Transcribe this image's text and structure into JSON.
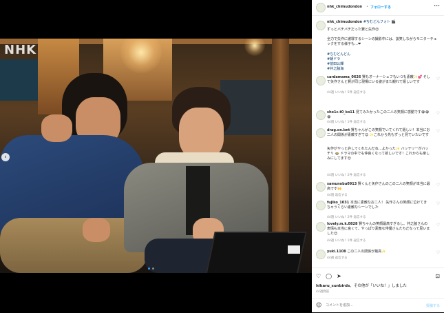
{
  "photo": {
    "watermark": "NHK"
  },
  "header": {
    "username": "nhk_chimudondon",
    "separator": "•",
    "follow": "フォローする",
    "more": "•••"
  },
  "caption": {
    "username": "nhk_chimudondon",
    "line1": "#ちむどんフォト 🎬",
    "line2": "ずっとバチバチだった賢と矢作😊",
    "line3": "全力で矢作に謝罪するシーンの撮影中には、談笑しながらモニターチェックをする様子も…❤",
    "tags": [
      "#ちむどんどん",
      "#朝ドラ",
      "#前田公輝",
      "#井之脇海"
    ]
  },
  "comments": [
    {
      "user": "cardamama_0626",
      "text": "賢もオーナーシェフもいつも素敵✨💕 そして矢作さんと賢が同じ現場にいる姿がまた観れて嬉しいです",
      "meta": [
        "44週",
        "いいね！5件",
        "返信する"
      ]
    },
    {
      "user": "sho1c.t0_ko11",
      "text": "見てみたかったこの二人の笑顔に感動です😭😭😭",
      "meta": [
        "44週",
        "いいね！1件",
        "返信する"
      ]
    },
    {
      "user": "drag.on.bnt",
      "text": "賢ちゃんがこの笑顔でいてくれて嬉しい！本当にお二人の関係が素敵すぎて😊 ✨これから先もずっと見ていたいです",
      "meta": [
        "44週",
        "いいね！4件",
        "返信する"
      ]
    },
    {
      "user": "",
      "text": "矢作がやっと許してくれたんだね…よかった✨ バッテリーがバッチリ 🍲 ドラマの中でも仲良くなって欲しいです！これからも楽しみにしてます😊",
      "meta": [
        "44週",
        "いいね！2件",
        "返信する"
      ]
    },
    {
      "user": "samunobu0913",
      "text": "賢くんと矢作さんのこの二人の笑顔が本当に最高です🙌",
      "meta": [
        "44週",
        "返信する"
      ]
    },
    {
      "user": "fujiko_1031",
      "text": "本当に素敵なお二人！ 矢作さんの笑顔に泣けてきちゃうくらい素敵なシーンでした",
      "meta": [
        "44週",
        "いいね！2件",
        "返信する"
      ]
    },
    {
      "user": "lovely.m.k.0828",
      "text": "賢ちゃんの笑顔最高すぎるし、井之脇さんの表情も本当に良くて、やっぱり素敵な俳優さんたちだなって思いました😊",
      "meta": [
        "44週",
        "いいね！1件",
        "返信する"
      ]
    },
    {
      "user": "yuki.1108",
      "text": "この二人の関係が最高✨",
      "meta": [
        "44週",
        "返信する"
      ]
    }
  ],
  "likes": {
    "prefix": "hikaru_sunbirds",
    "suffix": "、その他が「いいね！」しました"
  },
  "date": "44週間前",
  "comment_bar": {
    "placeholder": "コメントを追加...",
    "post": "投稿する"
  },
  "colors": {
    "accent": "#0095f6",
    "background": "#000000"
  }
}
